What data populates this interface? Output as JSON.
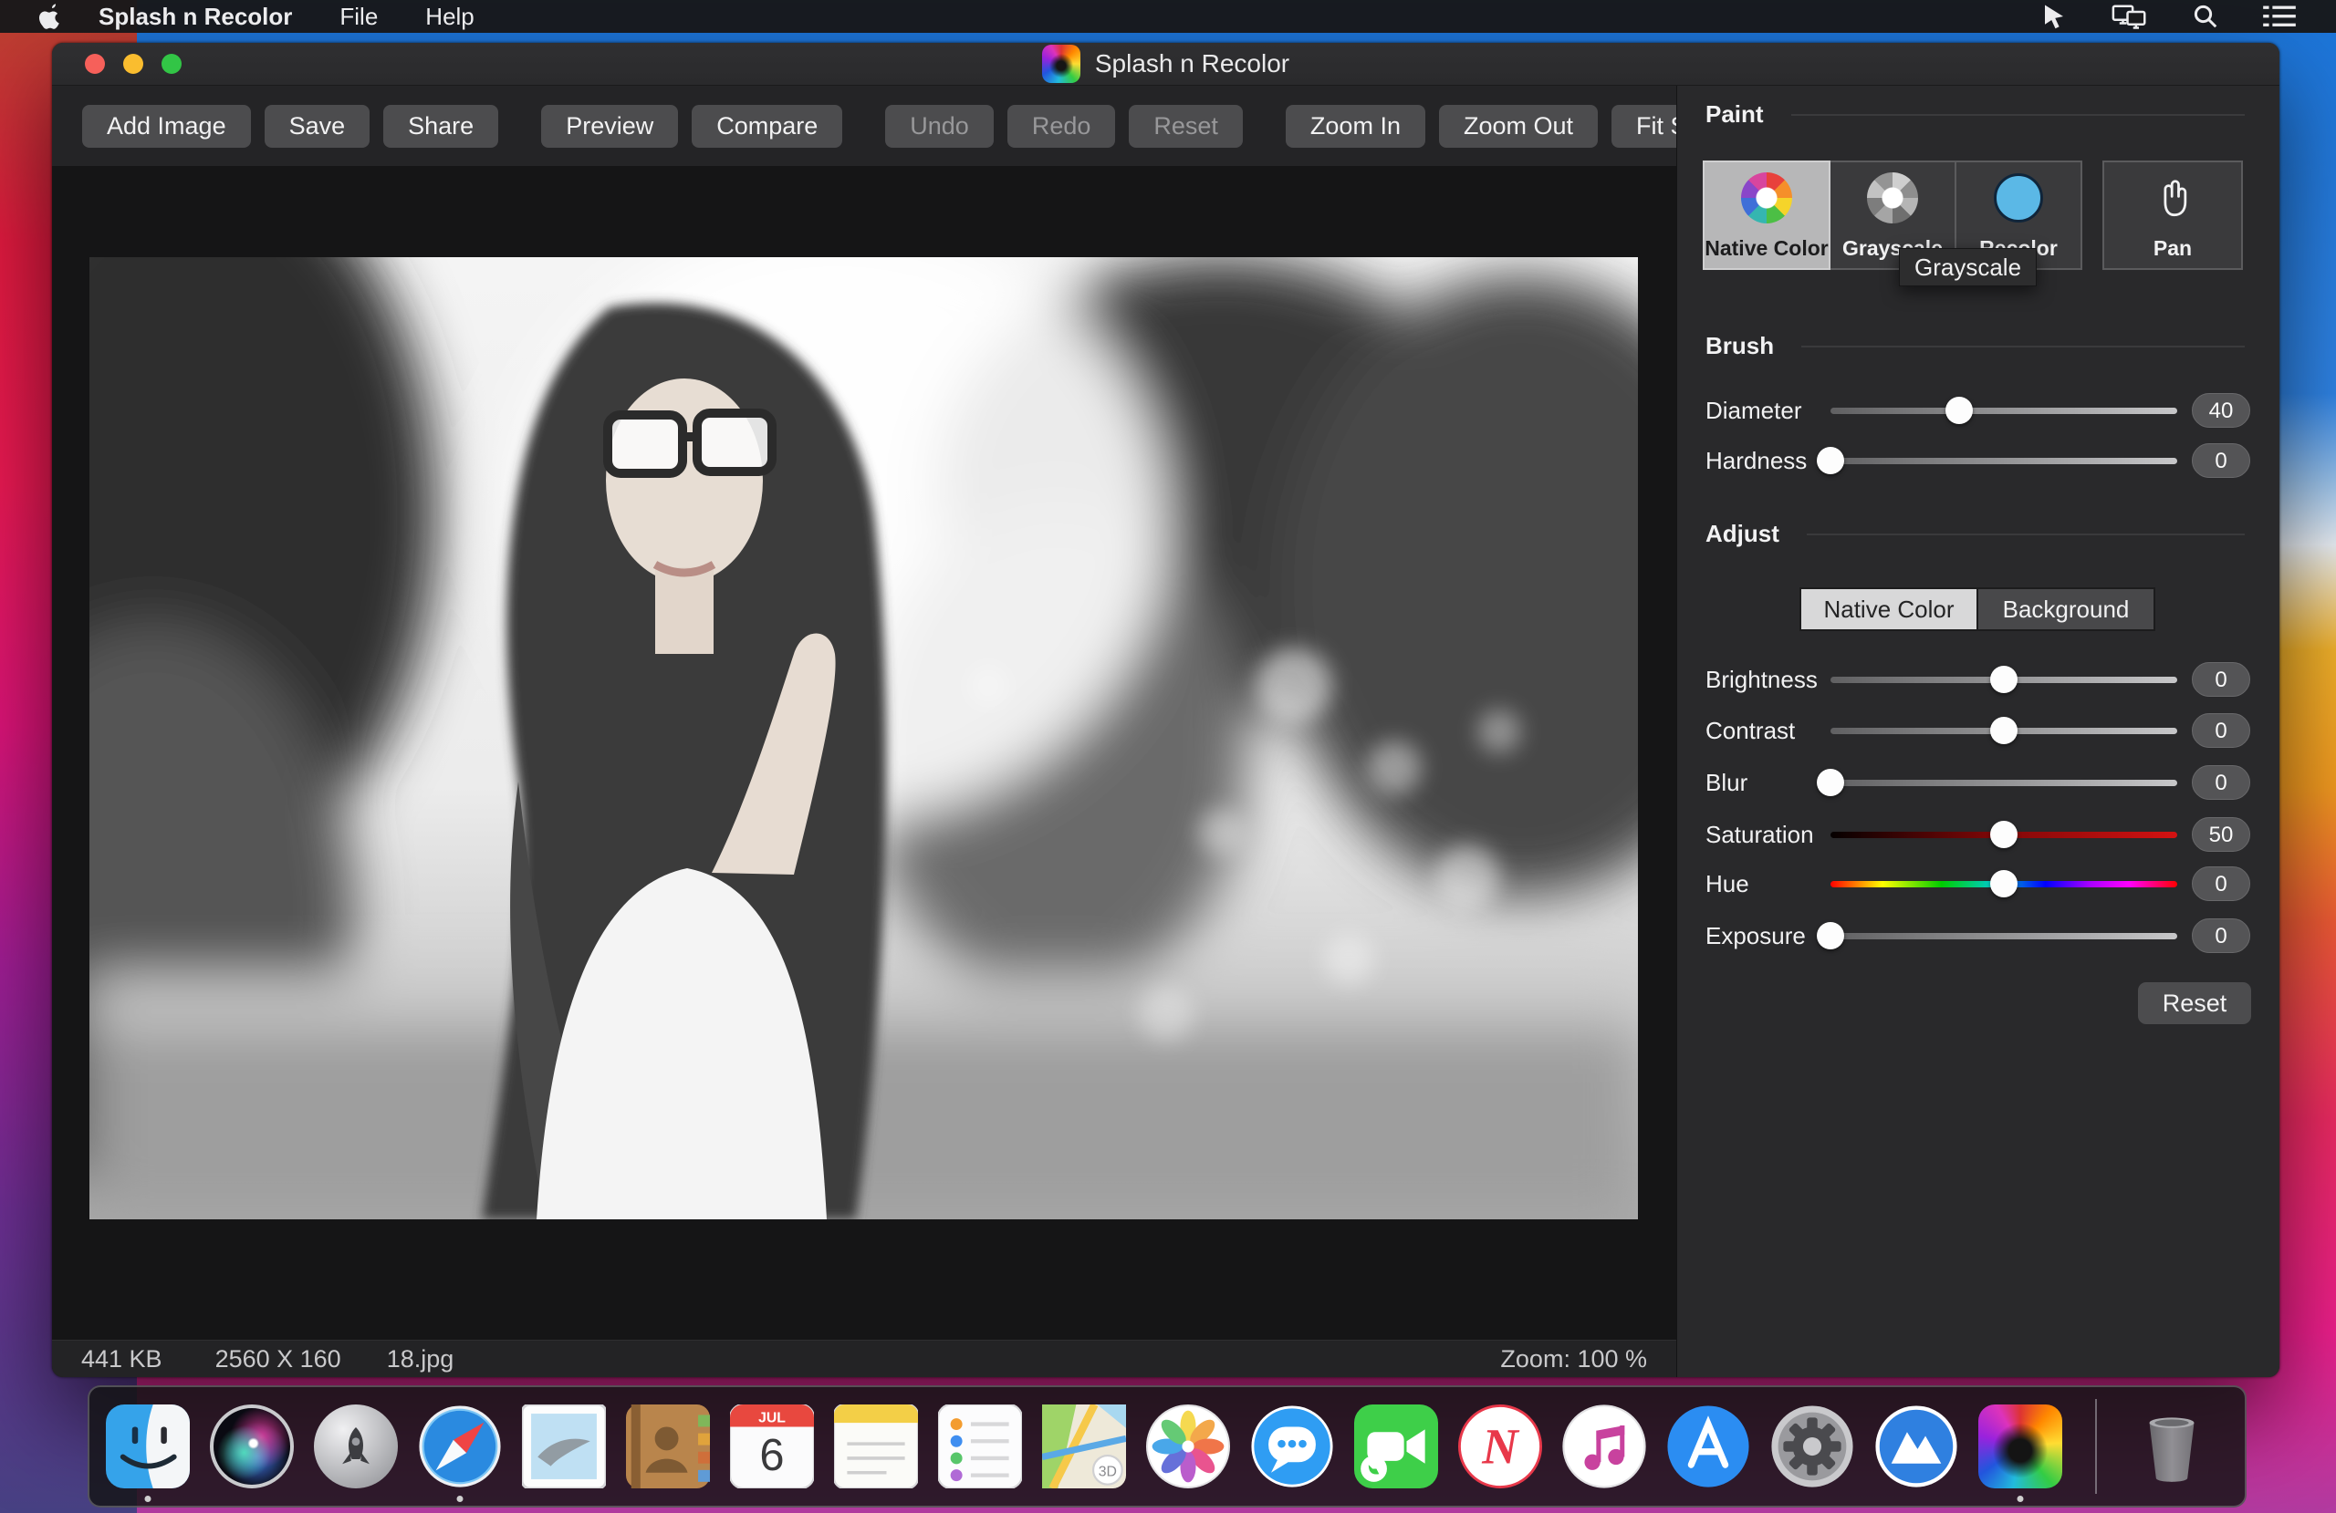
{
  "menu_bar": {
    "app_name": "Splash n Recolor",
    "menus": [
      "File",
      "Help"
    ],
    "right_icons": [
      "cursor-icon",
      "displays-icon",
      "search-icon",
      "list-icon"
    ]
  },
  "window": {
    "title": "Splash n Recolor",
    "traffic_lights": [
      "close",
      "minimize",
      "zoom"
    ],
    "toolbar": {
      "buttons": [
        {
          "label": "Add Image",
          "enabled": true
        },
        {
          "label": "Save",
          "enabled": true
        },
        {
          "label": "Share",
          "enabled": true
        },
        {
          "label": "Preview",
          "enabled": true
        },
        {
          "label": "Compare",
          "enabled": true
        },
        {
          "label": "Undo",
          "enabled": false
        },
        {
          "label": "Redo",
          "enabled": false
        },
        {
          "label": "Reset",
          "enabled": false
        },
        {
          "label": "Zoom In",
          "enabled": true
        },
        {
          "label": "Zoom Out",
          "enabled": true
        },
        {
          "label": "Fit Screen",
          "enabled": true
        }
      ]
    },
    "status_bar": {
      "file_size": "441 KB",
      "dimensions": "2560 X 160",
      "file_name": "18.jpg",
      "zoom_level": "Zoom: 100 %"
    }
  },
  "sidebar": {
    "paint": {
      "title": "Paint",
      "tools": [
        {
          "label": "Native Color",
          "selected": true,
          "icon": "color-wheel"
        },
        {
          "label": "Grayscale",
          "selected": false,
          "icon": "grayscale-wheel"
        },
        {
          "label": "Recolor",
          "selected": false,
          "icon": "blue-circle"
        },
        {
          "label": "Pan",
          "selected": false,
          "icon": "pan-hand"
        }
      ],
      "tooltip": "Grayscale"
    },
    "brush": {
      "title": "Brush",
      "sliders": {
        "diameter": {
          "label": "Diameter",
          "value": "40",
          "thumb_left": "37%"
        },
        "hardness": {
          "label": "Hardness",
          "value": "0",
          "thumb_left": "0%"
        }
      }
    },
    "adjust": {
      "title": "Adjust",
      "tabs": [
        {
          "label": "Native Color",
          "selected": true
        },
        {
          "label": "Background",
          "selected": false
        }
      ],
      "sliders": {
        "brightness": {
          "label": "Brightness",
          "value": "0",
          "thumb_left": "50%"
        },
        "contrast": {
          "label": "Contrast",
          "value": "0",
          "thumb_left": "50%"
        },
        "blur": {
          "label": "Blur",
          "value": "0",
          "thumb_left": "0%"
        },
        "saturation": {
          "label": "Saturation",
          "value": "50",
          "thumb_left": "50%"
        },
        "hue": {
          "label": "Hue",
          "value": "0",
          "thumb_left": "50%"
        },
        "exposure": {
          "label": "Exposure",
          "value": "0",
          "thumb_left": "0%"
        }
      },
      "reset_label": "Reset"
    }
  },
  "dock": {
    "items": [
      "finder",
      "siri",
      "launchpad",
      "safari",
      "mail",
      "contacts",
      "calendar",
      "notes",
      "reminders",
      "maps",
      "photos",
      "messages",
      "facetime",
      "news",
      "itunes",
      "app-store",
      "system-preferences",
      "mountain-app",
      "splash-n-recolor",
      "trash"
    ],
    "running": [
      "finder",
      "safari",
      "splash-n-recolor"
    ],
    "calendar_month": "JUL",
    "calendar_day": "6"
  },
  "colors": {
    "accent_blue": "#5bb8e6",
    "selected_tool_bg": "#b7b7b8",
    "sidebar_bg": "#29292b",
    "canvas_bg": "#151516",
    "tooltip_bg": "#2d2d2e",
    "traffic_red": "#f6605a",
    "traffic_yellow": "#fabd2f",
    "traffic_green": "#32c546"
  }
}
